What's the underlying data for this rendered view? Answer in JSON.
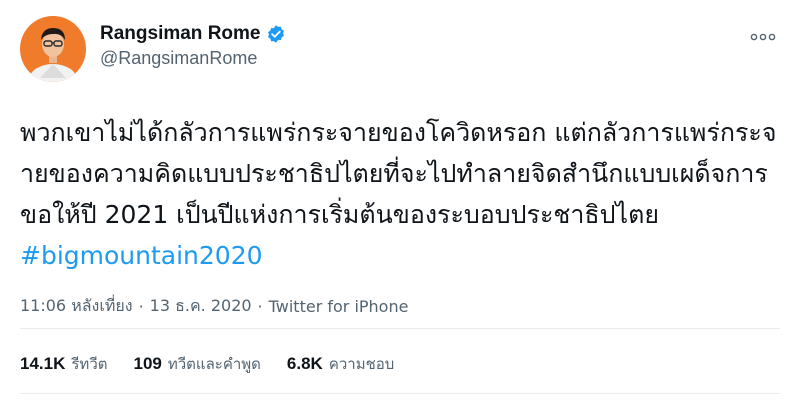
{
  "author": {
    "display_name": "Rangsiman Rome",
    "handle": "@RangsimanRome",
    "verified": true
  },
  "tweet": {
    "text": "พวกเขาไม่ได้กลัวการแพร่กระจายของโควิดหรอก แต่กลัวการแพร่กระจายของความคิดแบบประชาธิปไตยที่จะไปทำลายจิดสำนึกแบบเผด็จการ ขอให้ปี 2021 เป็นปีแห่งการเริ่มต้นของระบอบประชาธิปไตย ",
    "hashtag": "#bigmountain2020"
  },
  "meta": {
    "time": "11:06 หลังเที่ยง",
    "separator": "·",
    "date": "13 ธ.ค. 2020",
    "source": "Twitter for iPhone"
  },
  "stats": {
    "retweets": {
      "count": "14.1K",
      "label": "รีทวีต"
    },
    "quotes": {
      "count": "109",
      "label": "ทวีตและคำพูด"
    },
    "likes": {
      "count": "6.8K",
      "label": "ความชอบ"
    }
  },
  "colors": {
    "accent": "#1d9bf0",
    "muted": "#536471",
    "text": "#0f1419",
    "avatar_bg": "#f07b2b"
  },
  "icons": {
    "verified": "verified-badge-icon",
    "more": "more-horizontal-icon"
  }
}
